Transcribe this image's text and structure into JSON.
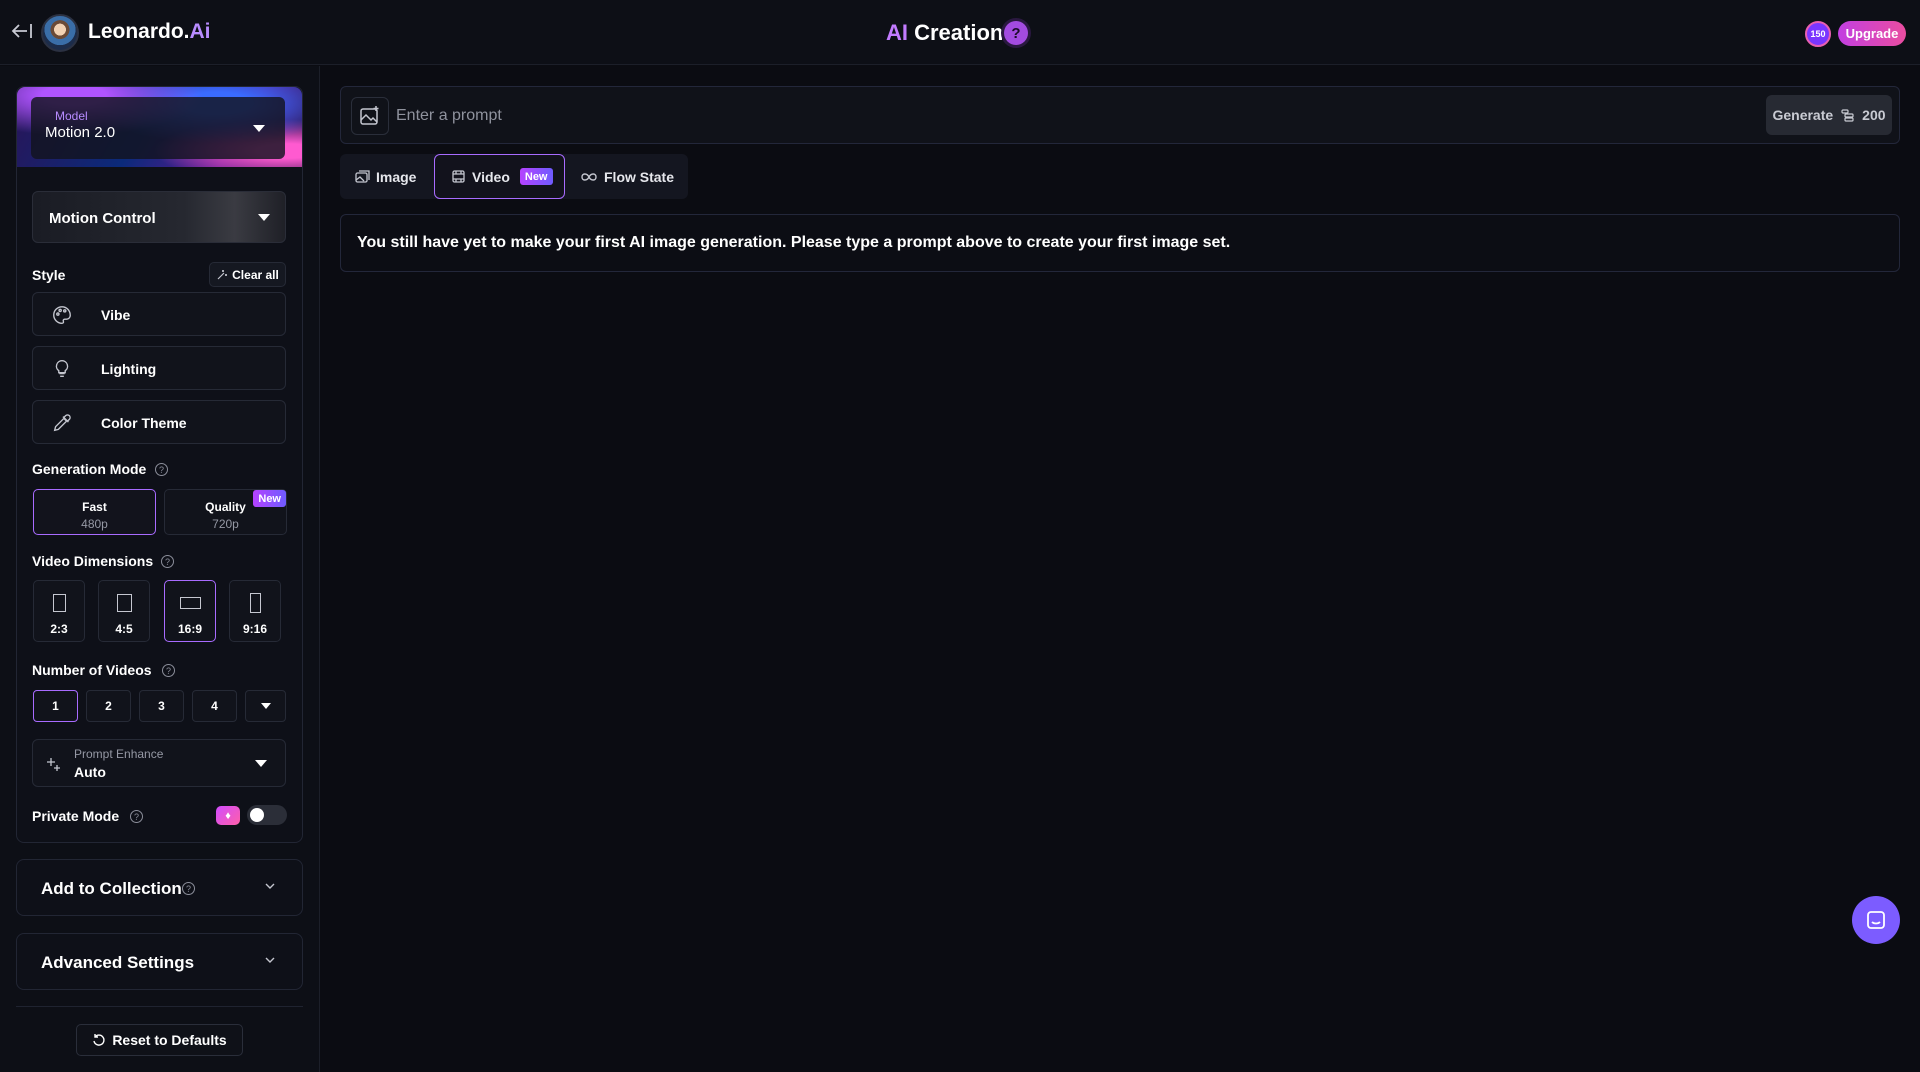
{
  "header": {
    "brand_main": "Leonardo.",
    "brand_ai": "Ai",
    "title_ai": "AI",
    "title_rest": " Creation",
    "help": "?",
    "tokens": "150",
    "upgrade": "Upgrade"
  },
  "sidebar": {
    "model_caption": "Model",
    "model_value": "Motion 2.0",
    "motion_control": "Motion Control",
    "style_label": "Style",
    "clear_all": "Clear all",
    "style_items": [
      {
        "label": "Vibe",
        "icon": "palette-icon"
      },
      {
        "label": "Lighting",
        "icon": "lightbulb-icon"
      },
      {
        "label": "Color Theme",
        "icon": "eyedropper-icon"
      }
    ],
    "generation_mode_label": "Generation Mode",
    "modes": [
      {
        "title": "Fast",
        "sub": "480p",
        "active": true
      },
      {
        "title": "Quality",
        "sub": "720p",
        "badge": "New",
        "active": false
      }
    ],
    "video_dimensions_label": "Video Dimensions",
    "dimensions": [
      {
        "label": "2:3"
      },
      {
        "label": "4:5"
      },
      {
        "label": "16:9",
        "active": true
      },
      {
        "label": "9:16"
      }
    ],
    "number_of_videos_label": "Number of Videos",
    "numbers": [
      "1",
      "2",
      "3",
      "4"
    ],
    "numbers_selected": "1",
    "prompt_enhance_caption": "Prompt Enhance",
    "prompt_enhance_value": "Auto",
    "private_mode_label": "Private Mode",
    "private_mode_on": false,
    "add_to_collection": "Add to Collection",
    "advanced_settings": "Advanced Settings",
    "reset": "Reset to Defaults"
  },
  "main": {
    "prompt_placeholder": "Enter a prompt",
    "generate_label": "Generate",
    "generate_cost": "200",
    "tabs": [
      {
        "label": "Image"
      },
      {
        "label": "Video",
        "badge": "New",
        "active": true
      },
      {
        "label": "Flow State"
      }
    ],
    "notice": "You still have yet to make your first AI image generation. Please type a prompt above to create your first image set."
  },
  "colors": {
    "accent": "#a86bff",
    "background": "#0b0c12",
    "upgrade_gradient_start": "#c23fe1",
    "upgrade_gradient_end": "#ea4da0",
    "chat_button": "#7c5cff"
  }
}
